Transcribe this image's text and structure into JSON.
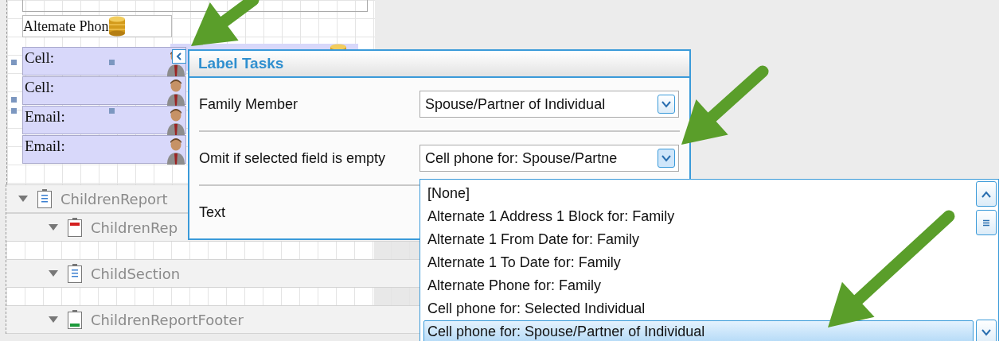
{
  "designer": {
    "fields": [
      {
        "label": "Altemate Phon",
        "kind": "db"
      },
      {
        "label": "Cell:",
        "kind": "person"
      },
      {
        "label": "Cell:",
        "kind": "person"
      },
      {
        "label": "Email:",
        "kind": "person"
      },
      {
        "label": "Email:",
        "kind": "person"
      }
    ],
    "bands": [
      {
        "name": "ChildrenReport",
        "kind": "report",
        "expanded": true,
        "children": [
          {
            "name": "ChildrenRep",
            "kind": "header",
            "expanded": true
          },
          {
            "name": "ChildSection",
            "kind": "detail",
            "expanded": true
          },
          {
            "name": "ChildrenReportFooter",
            "kind": "footer",
            "expanded": true
          }
        ]
      }
    ]
  },
  "label_tasks": {
    "title": "Label Tasks",
    "rows": [
      {
        "kind": "combo",
        "label": "Family Member",
        "value": "Spouse/Partner of Individual",
        "open": false
      },
      {
        "kind": "combo",
        "label": "Omit if selected field is empty",
        "value": "Cell phone for: Spouse/Partne",
        "open": true
      },
      {
        "kind": "text",
        "label": "Text"
      }
    ],
    "dropdown": [
      {
        "label": "[None]",
        "selected": false
      },
      {
        "label": "Alternate 1 Address 1 Block for: Family",
        "selected": false
      },
      {
        "label": "Alternate 1 From Date for: Family",
        "selected": false
      },
      {
        "label": "Alternate 1 To Date for: Family",
        "selected": false
      },
      {
        "label": "Alternate Phone for: Family",
        "selected": false
      },
      {
        "label": "Cell phone for: Selected Individual",
        "selected": false
      },
      {
        "label": "Cell phone for: Spouse/Partner of Individual",
        "selected": true
      }
    ]
  }
}
